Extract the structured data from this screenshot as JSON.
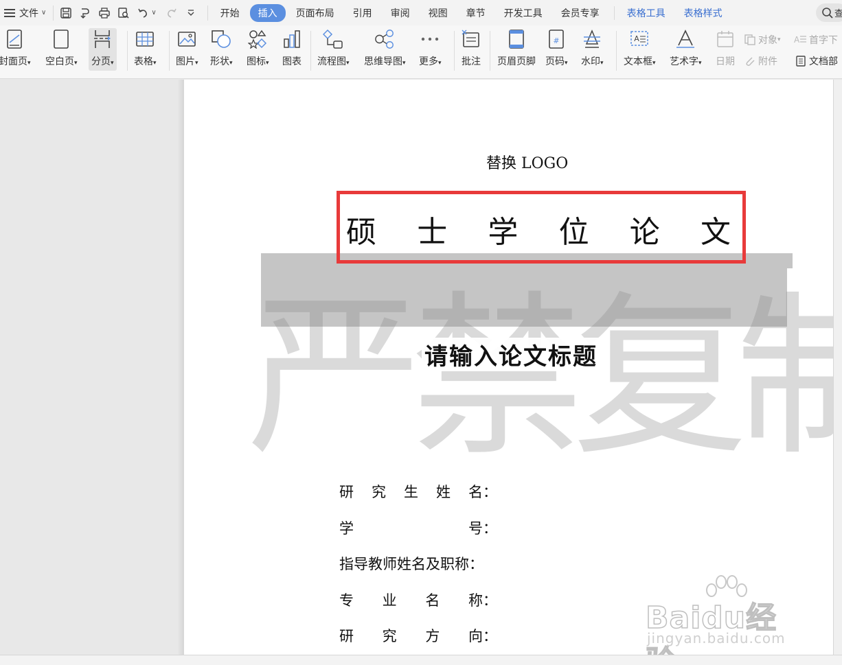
{
  "menubar": {
    "file_label": "文件",
    "tabs": [
      {
        "label": "开始"
      },
      {
        "label": "插入"
      },
      {
        "label": "页面布局"
      },
      {
        "label": "引用"
      },
      {
        "label": "审阅"
      },
      {
        "label": "视图"
      },
      {
        "label": "章节"
      },
      {
        "label": "开发工具"
      },
      {
        "label": "会员专享"
      },
      {
        "label": "表格工具"
      },
      {
        "label": "表格样式"
      }
    ],
    "active_tab": "插入",
    "search_label": "查"
  },
  "ribbon": {
    "cover_page": "封面页",
    "blank_page": "空白页",
    "page_break": "分页",
    "table": "表格",
    "picture": "图片",
    "shape": "形状",
    "icon": "图标",
    "chart": "图表",
    "flowchart": "流程图",
    "mindmap": "思维导图",
    "more": "更多",
    "comment": "批注",
    "header_footer": "页眉页脚",
    "page_number": "页码",
    "watermark": "水印",
    "textbox": "文本框",
    "wordart": "艺术字",
    "date": "日期",
    "object": "对象",
    "attachment": "附件",
    "dropcap": "首字下",
    "doc_parts": "文档部"
  },
  "document": {
    "logo_placeholder": "替换 LOGO",
    "degree_chars": [
      "硕",
      "士",
      "学",
      "位",
      "论",
      "文"
    ],
    "watermark_text": "严禁复制",
    "thesis_title": "请输入论文标题",
    "fields": [
      {
        "chars": [
          "研",
          "究",
          "生",
          "姓",
          "名："
        ]
      },
      {
        "chars": [
          "学",
          "号："
        ]
      },
      {
        "chars": [
          "指导教师姓名及职称："
        ]
      },
      {
        "chars": [
          "专",
          "业",
          "名",
          "称："
        ]
      },
      {
        "chars": [
          "研",
          "究",
          "方",
          "向："
        ]
      }
    ]
  },
  "baidu": {
    "main": "Baidu经验",
    "sub": "jingyan.baidu.com"
  },
  "colors": {
    "accent": "#5b8fe0",
    "highlight_box": "#e83a3a",
    "table_tools": "#3a6fd0"
  }
}
